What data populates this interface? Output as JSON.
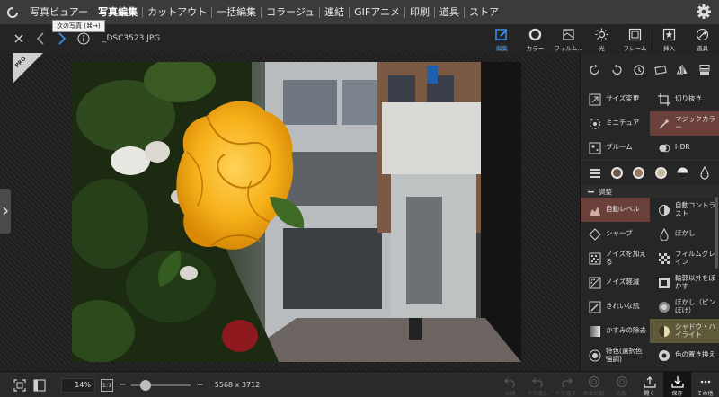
{
  "menubar": {
    "items": [
      "写真ビュアー",
      "写真編集",
      "カットアウト",
      "一括編集",
      "コラージュ",
      "連結",
      "GIFアニメ",
      "印刷",
      "道具",
      "ストア"
    ],
    "active_index": 1
  },
  "tooltip": {
    "text": "次の写真 (⌘→)"
  },
  "toolbar": {
    "filename": "_DSC3523.JPG",
    "tools": [
      "編集",
      "カラー",
      "フィルム...",
      "光",
      "フレーム",
      "挿入",
      "道具"
    ]
  },
  "badge": {
    "text": "PRO"
  },
  "panel": {
    "effects": [
      {
        "label": "サイズ変更",
        "icon": "resize-icon"
      },
      {
        "label": "切り抜き",
        "icon": "crop-icon"
      },
      {
        "label": "ミニチュア",
        "icon": "miniature-icon"
      },
      {
        "label": "マジックカラー",
        "icon": "magic-color-icon",
        "highlight": "red"
      },
      {
        "label": "ブルーム",
        "icon": "bloom-icon"
      },
      {
        "label": "HDR",
        "icon": "hdr-icon"
      }
    ],
    "section_title": "調整",
    "adjustments": [
      {
        "label": "自動レベル",
        "icon": "auto-level-icon",
        "highlight": "red"
      },
      {
        "label": "自動コントラ\nスト",
        "icon": "auto-contrast-icon"
      },
      {
        "label": "シャープ",
        "icon": "sharpen-icon"
      },
      {
        "label": "ぼかし",
        "icon": "blur-icon"
      },
      {
        "label": "ノイズを加え\nる",
        "icon": "add-noise-icon"
      },
      {
        "label": "フィルムグレ\nイン",
        "icon": "film-grain-icon"
      },
      {
        "label": "ノイズ軽減",
        "icon": "denoise-icon"
      },
      {
        "label": "輪郭以外をぼ\nかす",
        "icon": "edge-blur-icon"
      },
      {
        "label": "きれいな肌",
        "icon": "beauty-skin-icon"
      },
      {
        "label": "ぼかし（ピン\nぼけ）",
        "icon": "defocus-icon"
      },
      {
        "label": "かすみの除去",
        "icon": "dehaze-icon"
      },
      {
        "label": "シャドウ・ハ\nイライト",
        "icon": "shadow-highlight-icon",
        "highlight": "yellow"
      },
      {
        "label": "特色(選択色\n強調)",
        "icon": "spot-color-icon"
      },
      {
        "label": "色の置き換え",
        "icon": "color-replace-icon"
      }
    ]
  },
  "bottombar": {
    "zoom": "14%",
    "ratio_label": "1:1",
    "zoom_level": 0.14,
    "minus": "−",
    "plus": "+",
    "dimensions": "5568 x 3712",
    "actions": [
      "元便",
      "やり直し",
      "やり直す",
      "原本比較",
      "比較",
      "開く",
      "保存",
      "その他"
    ]
  }
}
